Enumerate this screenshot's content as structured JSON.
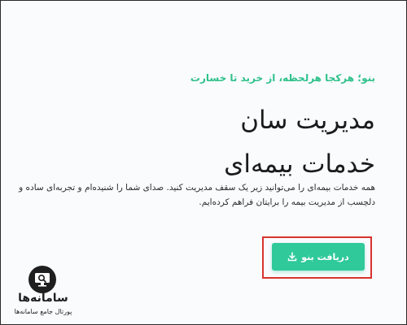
{
  "hero": {
    "tagline": "بنو؛ هرکجا هرلحظه، از خرید تا خسارت",
    "headline_line1": "مدیریت  سان",
    "headline_line2": "خدمات بیمه‌ای",
    "description": "همه خدمات بیمه‌ای را می‌توانید زیر یک سقف مدیریت کنید. صدای شما را شنیده‌ام و تجربه‌ای ساده و دلچسب از مدیریت بیمه را برایتان فراهم کرده‌ایم."
  },
  "cta": {
    "label": "دریافت بنو",
    "icon": "download-icon"
  },
  "watermark": {
    "name": "سامانه‌ها",
    "subtitle": "پورتال جامع سامانه‌ها",
    "icon": "search-monitor-icon"
  },
  "colors": {
    "accent": "#2fc18a",
    "button": "#2fc99a",
    "highlight": "#d8342f",
    "text": "#1b1b1b"
  }
}
